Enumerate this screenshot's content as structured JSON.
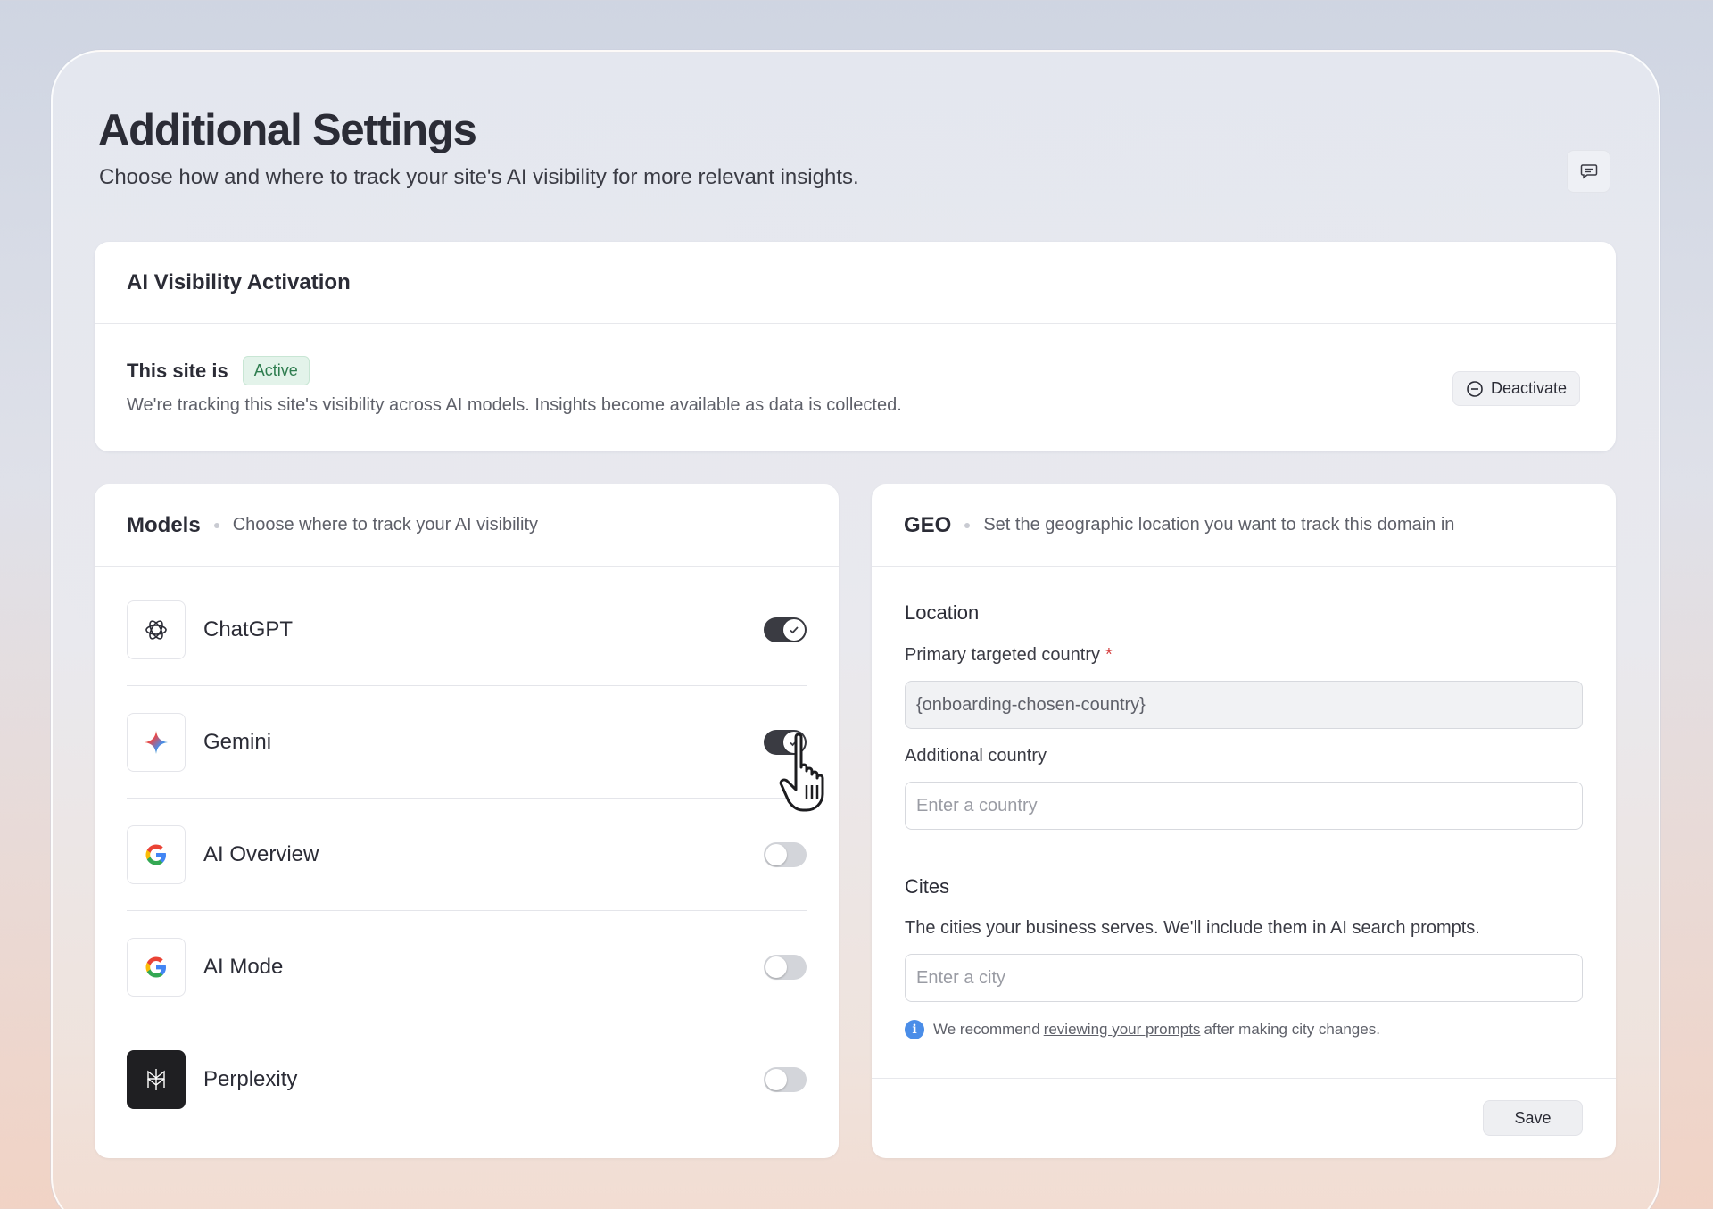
{
  "page": {
    "title": "Additional Settings",
    "subtitle": "Choose how and where to track your site's AI visibility for more relevant insights.",
    "feedback_icon": "chat-bubble-icon"
  },
  "activation": {
    "title": "AI Visibility Activation",
    "site_label": "This site is",
    "status": "Active",
    "description": "We're tracking this site's visibility across AI models. Insights become available as data is collected.",
    "deactivate_label": "Deactivate",
    "status_color": "#2e7d4f"
  },
  "models": {
    "title": "Models",
    "description": "Choose where to track your AI visibility",
    "items": [
      {
        "name": "ChatGPT",
        "icon": "openai-icon",
        "enabled": true
      },
      {
        "name": "Gemini",
        "icon": "gemini-icon",
        "enabled": true
      },
      {
        "name": "AI Overview",
        "icon": "google-icon",
        "enabled": false
      },
      {
        "name": "AI Mode",
        "icon": "google-icon",
        "enabled": false
      },
      {
        "name": "Perplexity",
        "icon": "perplexity-icon",
        "enabled": false
      }
    ]
  },
  "geo": {
    "title": "GEO",
    "description": "Set the geographic location you want to track this domain in",
    "location_title": "Location",
    "primary_label": "Primary targeted country",
    "required_mark": "*",
    "primary_value": "{onboarding-chosen-country}",
    "additional_label": "Additional country",
    "additional_placeholder": "Enter a country",
    "cities_title": "Cites",
    "cities_description": "The cities your business serves. We'll include them in AI search prompts.",
    "city_placeholder": "Enter a city",
    "note_prefix": "We recommend",
    "note_link": "reviewing your prompts",
    "note_suffix": "after making city changes.",
    "save_label": "Save"
  }
}
